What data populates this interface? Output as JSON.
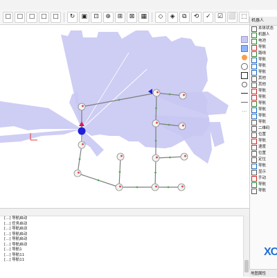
{
  "toolbar": {
    "buttons": [
      {
        "name": "tool-1-icon",
        "glyph": "□"
      },
      {
        "name": "tool-2-icon",
        "glyph": "□"
      },
      {
        "name": "tool-3-icon",
        "glyph": "□"
      },
      {
        "name": "tool-4-icon",
        "glyph": "□"
      },
      {
        "name": "tool-5-icon",
        "glyph": "□"
      },
      {
        "name": "tool-6-icon",
        "glyph": "↻"
      },
      {
        "name": "tool-7-icon",
        "glyph": "▣"
      },
      {
        "name": "tool-8-icon",
        "glyph": "⊡"
      },
      {
        "name": "tool-9-icon",
        "glyph": "⊕"
      },
      {
        "name": "tool-10-icon",
        "glyph": "⊞"
      },
      {
        "name": "tool-11-icon",
        "glyph": "⊠"
      },
      {
        "name": "tool-12-icon",
        "glyph": "▦"
      },
      {
        "name": "tool-13-icon",
        "glyph": "◇"
      },
      {
        "name": "tool-14-icon",
        "glyph": "◈"
      },
      {
        "name": "tool-15-icon",
        "glyph": "⧉"
      },
      {
        "name": "tool-16-icon",
        "glyph": "⟲"
      },
      {
        "name": "tool-17-icon",
        "glyph": "✓"
      },
      {
        "name": "tool-18-icon",
        "glyph": "☑"
      },
      {
        "name": "tool-19-icon",
        "glyph": "⬜"
      },
      {
        "name": "tool-20-icon",
        "glyph": "⬚"
      }
    ]
  },
  "canvas": {
    "scan_color": "#c9c8f3",
    "edge_color": "#7c7c7c",
    "node_fill": "#f2f2f2",
    "node_stroke": "#8a8a8a",
    "node_mark": "#d9534f",
    "robot_color": "#1f1fd6",
    "legend_items": [
      {
        "label": "",
        "symbol": "square-lavender"
      },
      {
        "label": "",
        "symbol": "square-blue"
      },
      {
        "label": "",
        "symbol": "circle"
      },
      {
        "label": "",
        "symbol": "circle-open"
      },
      {
        "label": "",
        "symbol": "square-black"
      },
      {
        "label": "",
        "symbol": "circle-small"
      },
      {
        "label": "",
        "symbol": "line"
      },
      {
        "label": "",
        "symbol": "line-arrow"
      },
      {
        "label": "",
        "symbol": "dots"
      }
    ]
  },
  "right_panel": {
    "header": "机器人",
    "items": [
      "本体状态",
      "机器人",
      "电池",
      "导航",
      "路线",
      "导航",
      "导航",
      "导航",
      "其他",
      "其他",
      "导航",
      "导航",
      "导航",
      "导航",
      "导航",
      "导航",
      "二维码",
      "位置",
      "导航",
      "速度",
      "位置",
      "定位",
      "导航",
      "显示",
      "手动",
      "导航",
      "导航"
    ],
    "footer": "地图属性"
  },
  "log": {
    "lines": [
      "[...] 导航启动",
      "[...] 任务启动",
      "[...] 导航启动",
      "[...] 导航启动",
      "[...] 导航启动",
      "[...] 导航启动",
      "[...] 导航1",
      "[...] 导航11",
      "[...] 导航11"
    ]
  },
  "brand": {
    "logo_text": "XC"
  }
}
